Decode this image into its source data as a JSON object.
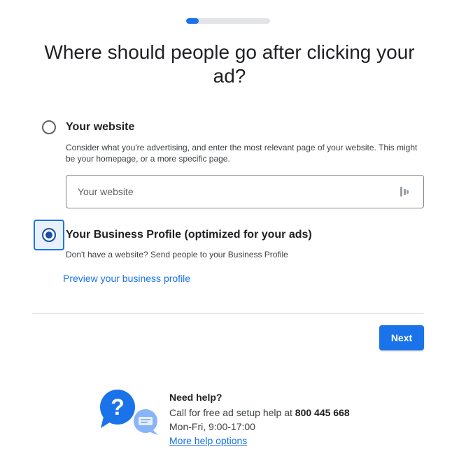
{
  "progress": {
    "fraction": 0.15
  },
  "title": "Where should people go after clicking your ad?",
  "options": {
    "website": {
      "label": "Your website",
      "description": "Consider what you're advertising, and enter the most relevant page of your website. This might be your homepage, or a more specific page.",
      "input_placeholder": "Your website",
      "input_value": "",
      "selected": false
    },
    "business_profile": {
      "label": "Your Business Profile (optimized for your ads)",
      "description": "Don't have a website? Send people to your Business Profile",
      "selected": true
    }
  },
  "preview_link": "Preview your business profile",
  "next_button": "Next",
  "help": {
    "title": "Need help?",
    "call_text": "Call for free ad setup help at ",
    "phone": "800 445 668",
    "hours": "Mon-Fri, 9:00-17:00",
    "more_link": "More help options"
  },
  "colors": {
    "accent": "#1a73e8",
    "selected_radio": "#174ea6",
    "text": "#202124"
  },
  "icons": {
    "input_icon": "password-manager-key-icon",
    "help_icon": "help-chat-bubbles-icon"
  }
}
